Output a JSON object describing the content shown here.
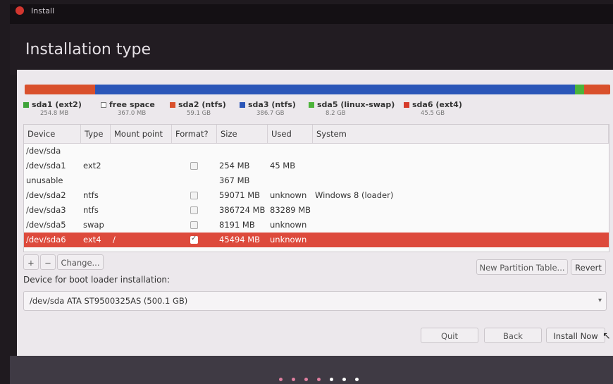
{
  "window": {
    "title": "Install"
  },
  "page": {
    "title": "Installation type"
  },
  "usage_bar": [
    {
      "color": "#d9502c",
      "fraction": 0.12
    },
    {
      "color": "#2b56b8",
      "fraction": 0.82
    },
    {
      "color": "#4cb33a",
      "fraction": 0.015
    },
    {
      "color": "#d9502c",
      "fraction": 0.045
    }
  ],
  "legend": [
    {
      "name": "sda1 (ext2)",
      "size": "254.8 MB",
      "color": "#3fa33a",
      "outline": false
    },
    {
      "name": "free space",
      "size": "367.0 MB",
      "color": "#ffffff",
      "outline": true
    },
    {
      "name": "sda2 (ntfs)",
      "size": "59.1 GB",
      "color": "#d9502c",
      "outline": false
    },
    {
      "name": "sda3 (ntfs)",
      "size": "386.7 GB",
      "color": "#2b56b8",
      "outline": false
    },
    {
      "name": "sda5 (linux-swap)",
      "size": "8.2 GB",
      "color": "#4cb33a",
      "outline": false
    },
    {
      "name": "sda6 (ext4)",
      "size": "45.5 GB",
      "color": "#d63b2b",
      "outline": false
    }
  ],
  "table": {
    "headers": [
      "Device",
      "Type",
      "Mount point",
      "Format?",
      "Size",
      "Used",
      "System"
    ],
    "rows": [
      {
        "device": "/dev/sda",
        "type": "",
        "mount": "",
        "format": null,
        "size": "",
        "used": "",
        "system": "",
        "selected": false
      },
      {
        "device": "/dev/sda1",
        "type": "ext2",
        "mount": "",
        "format": false,
        "size": "254 MB",
        "used": "45 MB",
        "system": "",
        "selected": false
      },
      {
        "device": "unusable",
        "type": "",
        "mount": "",
        "format": null,
        "size": "367 MB",
        "used": "",
        "system": "",
        "selected": false
      },
      {
        "device": "/dev/sda2",
        "type": "ntfs",
        "mount": "",
        "format": false,
        "size": "59071 MB",
        "used": "unknown",
        "system": "Windows 8 (loader)",
        "selected": false
      },
      {
        "device": "/dev/sda3",
        "type": "ntfs",
        "mount": "",
        "format": false,
        "size": "386724 MB",
        "used": "83289 MB",
        "system": "",
        "selected": false
      },
      {
        "device": "/dev/sda5",
        "type": "swap",
        "mount": "",
        "format": false,
        "size": "8191 MB",
        "used": "unknown",
        "system": "",
        "selected": false
      },
      {
        "device": "/dev/sda6",
        "type": "ext4",
        "mount": "/",
        "format": true,
        "size": "45494 MB",
        "used": "unknown",
        "system": "",
        "selected": true
      }
    ]
  },
  "partition_buttons": {
    "add": "+",
    "remove": "−",
    "change": "Change..."
  },
  "table_buttons": {
    "new_table": "New Partition Table...",
    "revert": "Revert"
  },
  "boot_loader": {
    "label": "Device for boot loader installation:",
    "value": "/dev/sda   ATA ST9500325AS (500.1 GB)",
    "arrow": "▾"
  },
  "nav_buttons": {
    "quit": "Quit",
    "back": "Back",
    "install": "Install Now"
  },
  "progress_dots": {
    "total": 7,
    "current": 4,
    "active_color": "#ffffff",
    "done_color": "#e07fa0"
  },
  "checkmark": "✓"
}
